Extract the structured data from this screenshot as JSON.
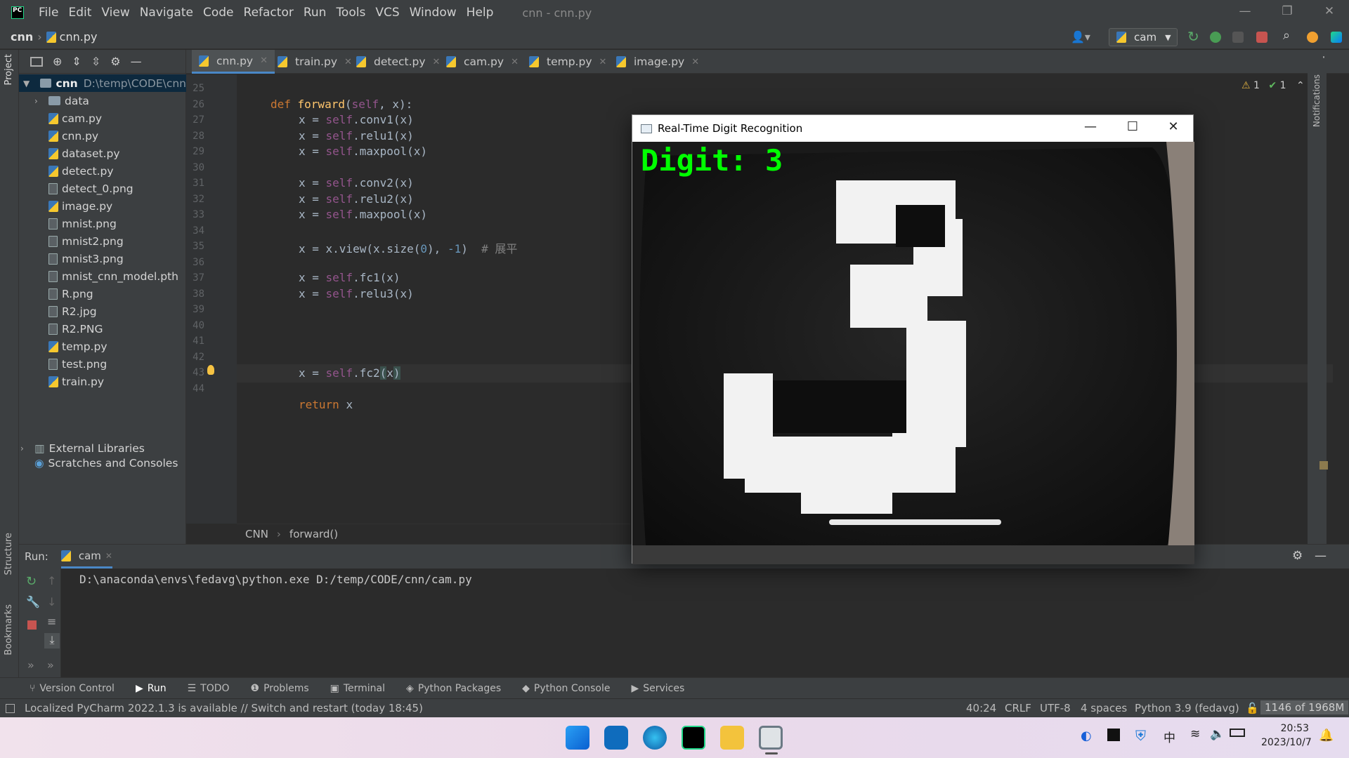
{
  "menubar": {
    "items": [
      "File",
      "Edit",
      "View",
      "Navigate",
      "Code",
      "Refactor",
      "Run",
      "Tools",
      "VCS",
      "Window",
      "Help"
    ],
    "window_title": "cnn - cnn.py"
  },
  "navbar": {
    "project": "cnn",
    "file": "cnn.py",
    "run_config": "cam"
  },
  "project_panel": {
    "label": "Project",
    "root_name": "cnn",
    "root_path": "D:\\temp\\CODE\\cnn",
    "items": [
      {
        "name": "data",
        "type": "folder"
      },
      {
        "name": "cam.py",
        "type": "py"
      },
      {
        "name": "cnn.py",
        "type": "py"
      },
      {
        "name": "dataset.py",
        "type": "py"
      },
      {
        "name": "detect.py",
        "type": "py"
      },
      {
        "name": "detect_0.png",
        "type": "file"
      },
      {
        "name": "image.py",
        "type": "py"
      },
      {
        "name": "mnist.png",
        "type": "file"
      },
      {
        "name": "mnist2.png",
        "type": "file"
      },
      {
        "name": "mnist3.png",
        "type": "file"
      },
      {
        "name": "mnist_cnn_model.pth",
        "type": "file"
      },
      {
        "name": "R.png",
        "type": "file"
      },
      {
        "name": "R2.jpg",
        "type": "file"
      },
      {
        "name": "R2.PNG",
        "type": "file"
      },
      {
        "name": "temp.py",
        "type": "py"
      },
      {
        "name": "test.png",
        "type": "file"
      },
      {
        "name": "train.py",
        "type": "py"
      }
    ],
    "external_libraries": "External Libraries",
    "scratches": "Scratches and Consoles"
  },
  "tabs": [
    "cnn.py",
    "train.py",
    "detect.py",
    "cam.py",
    "temp.py",
    "image.py"
  ],
  "editor": {
    "line_numbers": [
      "25",
      "26",
      "27",
      "28",
      "29",
      "30",
      "31",
      "32",
      "33",
      "34",
      "35",
      "36",
      "37",
      "38",
      "39",
      "40",
      "41",
      "42",
      "43",
      "44"
    ],
    "inspections": {
      "warnings": "1",
      "ok": "1"
    },
    "breadcrumb_class": "CNN",
    "breadcrumb_method": "forward()"
  },
  "left_strip": {
    "structure": "Structure",
    "bookmarks": "Bookmarks"
  },
  "right_strip": {
    "notifications": "Notifications"
  },
  "run": {
    "label": "Run:",
    "tab": "cam",
    "console": "D:\\anaconda\\envs\\fedavg\\python.exe D:/temp/CODE/cnn/cam.py"
  },
  "tool_windows": [
    "Version Control",
    "Run",
    "TODO",
    "Problems",
    "Terminal",
    "Python Packages",
    "Python Console",
    "Services"
  ],
  "statusbar": {
    "message": "Localized PyCharm 2022.1.3 is available // Switch and restart (today 18:45)",
    "position": "40:24",
    "line_sep": "CRLF",
    "encoding": "UTF-8",
    "indent": "4 spaces",
    "interpreter": "Python 3.9 (fedavg)",
    "memory": "1146 of 1968M"
  },
  "popup": {
    "title": "Real-Time Digit Recognition",
    "overlay": "Digit: 3"
  },
  "taskbar": {
    "ime": "中",
    "time": "20:53",
    "date": "2023/10/7"
  },
  "colors": {
    "accent": "#4a88c7",
    "digit_green": "#00ff00"
  }
}
